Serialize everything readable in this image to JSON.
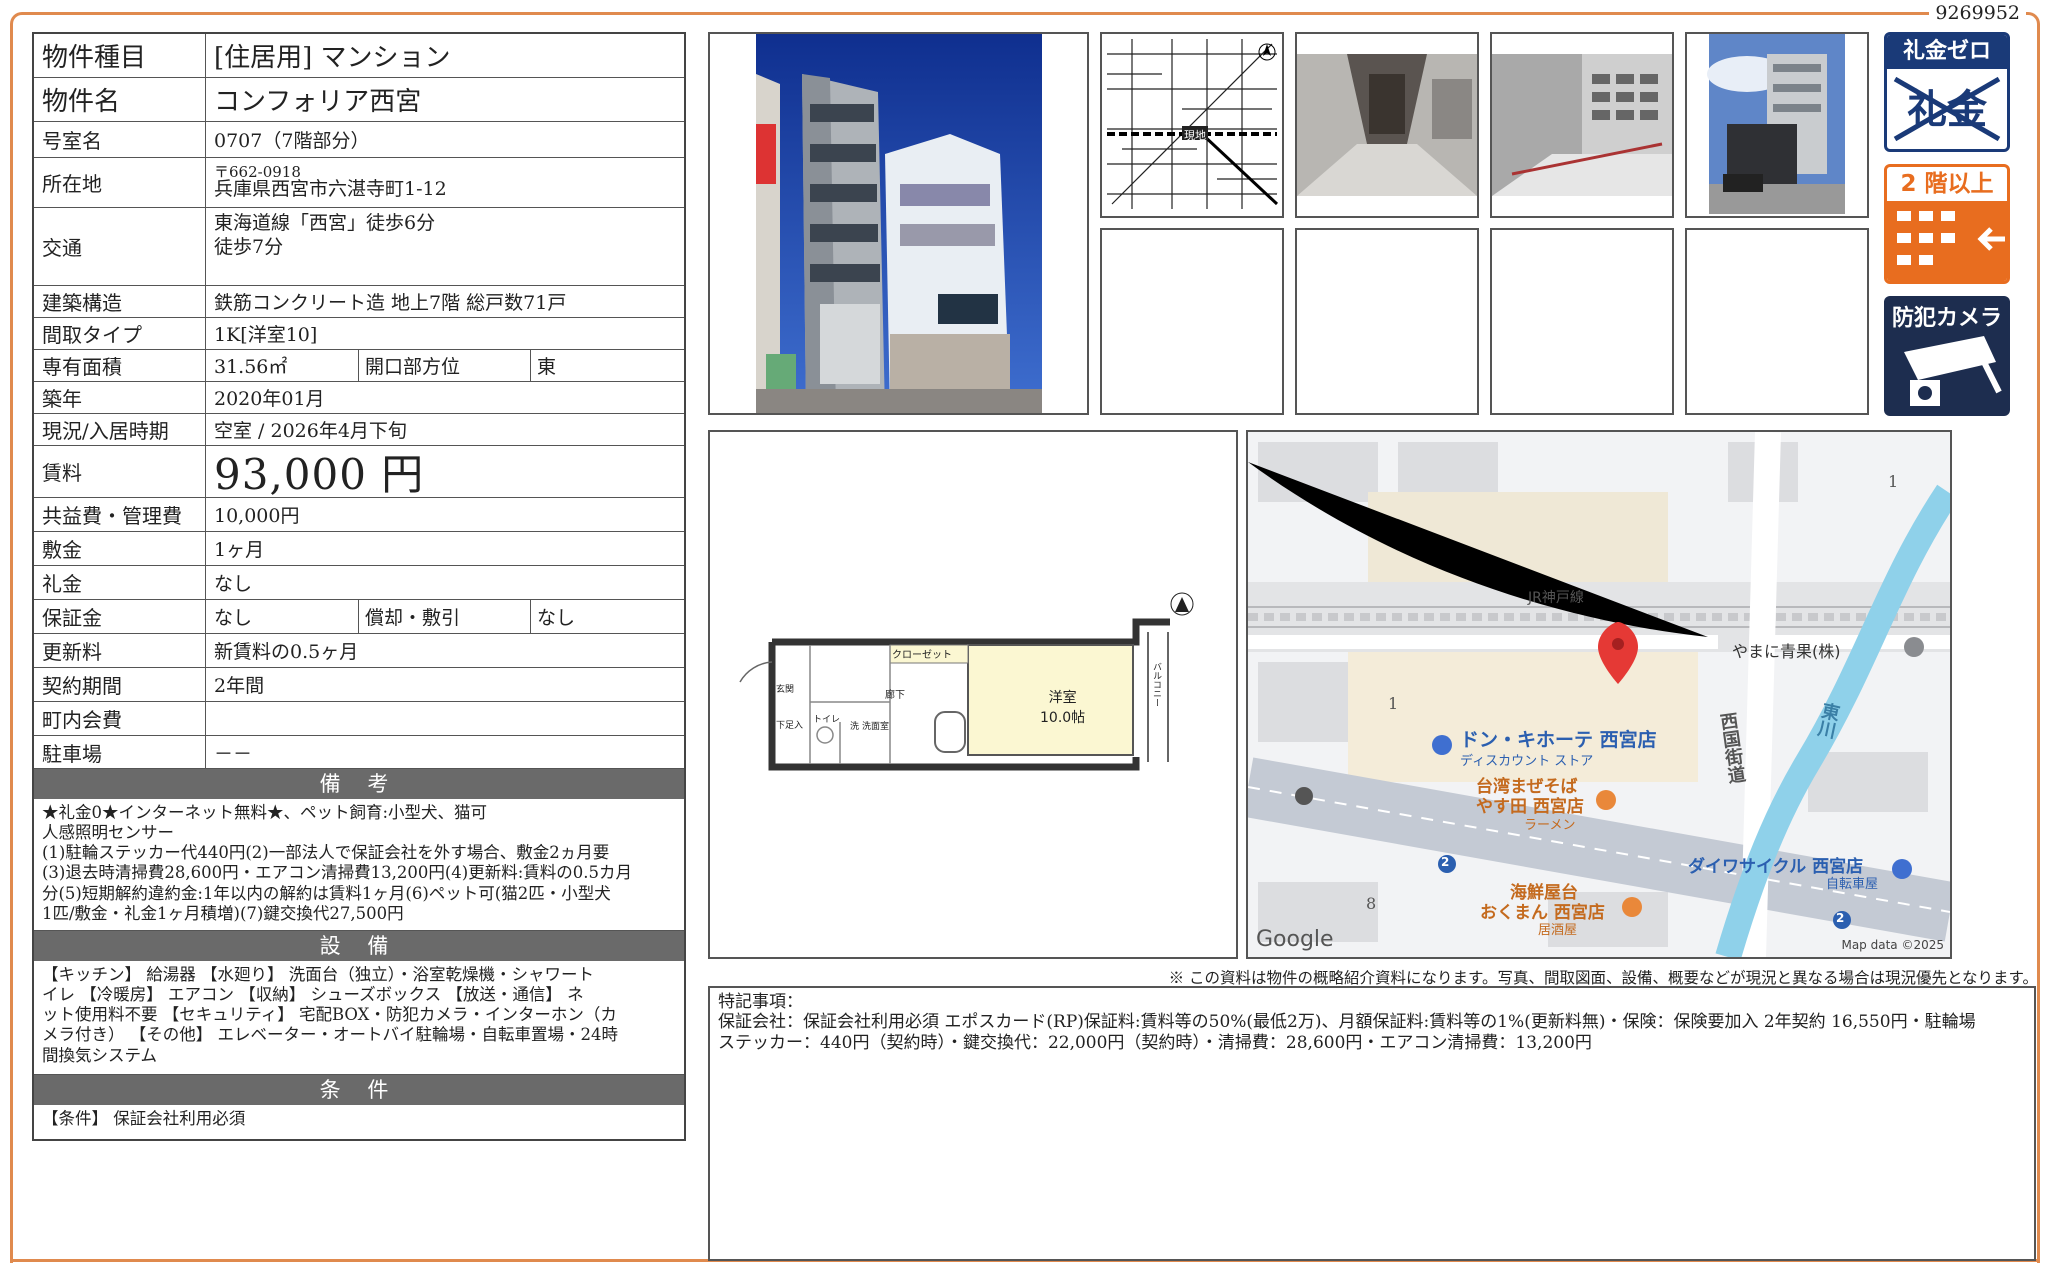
{
  "doc_id": "9269952",
  "property": {
    "type_label": "物件種目",
    "type_value": "[住居用]  マンション",
    "name_label": "物件名",
    "name_value": "コンフォリア西宮",
    "room_label": "号室名",
    "room_value": "0707（7階部分）",
    "address_label": "所在地",
    "zip": "〒662-0918",
    "address": "兵庫県西宮市六湛寺町1-12",
    "transport_label": "交通",
    "transport_1": "東海道線「西宮」徒歩6分",
    "transport_2": "徒歩7分",
    "structure_label": "建築構造",
    "structure_value": "鉄筋コンクリート造  地上7階  総戸数71戸",
    "layout_label": "間取タイプ",
    "layout_value": "1K[洋室10]",
    "area_label": "専有面積",
    "area_value": "31.56㎡",
    "direction_label": "開口部方位",
    "direction_value": "東",
    "built_label": "築年",
    "built_value": "2020年01月",
    "status_label": "現況/入居時期",
    "status_value": "空室  /  2026年4月下旬",
    "rent_label": "賃料",
    "rent_value": "93,000 円",
    "fee_label": "共益費・管理費",
    "fee_value": "10,000円",
    "deposit_label": "敷金",
    "deposit_value": "1ヶ月",
    "key_money_label": "礼金",
    "key_money_value": "なし",
    "guarantee_label": "保証金",
    "guarantee_value": "なし",
    "amort_label": "償却・敷引",
    "amort_value": "なし",
    "renewal_label": "更新料",
    "renewal_value": "新賃料の0.5ヶ月",
    "contract_label": "契約期間",
    "contract_value": "2年間",
    "town_fee_label": "町内会費",
    "town_fee_value": "",
    "parking_label": "駐車場",
    "parking_value": "－－"
  },
  "remarks": {
    "title": "備 考",
    "lines": [
      "★礼金0★インターネット無料★、ペット飼育:小型犬、猫可",
      "人感照明センサー",
      "(1)駐輪ステッカー代440円(2)一部法人で保証会社を外す場合、敷金2ヵ月要",
      "(3)退去時清掃費28,600円・エアコン清掃費13,200円(4)更新料:賃料の0.5カ月",
      "分(5)短期解約違約金:1年以内の解約は賃料1ヶ月(6)ペット可(猫2匹・小型犬",
      "1匹/敷金・礼金1ヶ月積増)(7)鍵交換代27,500円"
    ]
  },
  "equipment": {
    "title": "設 備",
    "lines": [
      "【キッチン】 給湯器 【水廻り】 洗面台（独立）・浴室乾燥機・シャワート",
      "イレ 【冷暖房】 エアコン 【収納】 シューズボックス 【放送・通信】 ネ",
      "ット使用料不要 【セキュリティ】 宅配BOX・防犯カメラ・インターホン（カ",
      "メラ付き） 【その他】 エレベーター・オートバイ駐輪場・自転車置場・24時",
      "間換気システム"
    ]
  },
  "conditions": {
    "title": "条 件",
    "text": "【条件】  保証会社利用必須"
  },
  "badges": {
    "reikin_zero_top": "礼金ゼロ",
    "reikin_zero_crossed": "礼金",
    "floor2": "2 階以上",
    "camera": "防犯カメラ"
  },
  "floorplan": {
    "room_label": "洋室",
    "room_size": "10.0帖",
    "closet": "クローゼット",
    "hall": "廊下",
    "entrance": "玄関",
    "shoebox": "下足入",
    "toilet": "トイレ",
    "wash": "洗",
    "washroom": "洗面室",
    "balcony": "バルコニー"
  },
  "map": {
    "rail_label": "JR神戸線",
    "shop1": "やまに青果(株)",
    "store_name": "ドン・キホーテ 西宮店",
    "store_sub": "ディスカウント ストア",
    "ramen_1": "台湾まぜそば",
    "ramen_2": "やす田 西宮店",
    "ramen_sub": "ラーメン",
    "izakaya_1": "海鮮屋台",
    "izakaya_2": "おくまん 西宮店",
    "izakaya_sub": "居酒屋",
    "cycle_name": "ダイワサイクル 西宮店",
    "cycle_sub": "自転車屋",
    "street1": "西国街道",
    "river": "東川",
    "num1": "1",
    "num2": "1",
    "num3": "8",
    "route1": "2",
    "route2": "2",
    "google": "Google",
    "copyright": "Map data ©2025"
  },
  "location_map_label": "現地",
  "disclaimer": "※ この資料は物件の概略紹介資料になります。写真、間取図面、設備、概要などが現況と異なる場合は現況優先となります。",
  "special_notes": {
    "title": "特記事項：",
    "line1": "保証会社：保証会社利用必須 エポスカード(RP)保証料:賃料等の50%(最低2万)、月額保証料:賃料等の1%(更新料無)・保険：保険要加入 2年契約 16,550円・駐輪場",
    "line2": "ステッカー：440円（契約時）・鍵交換代：22,000円（契約時）・清掃費：28,600円・エアコン清掃費：13,200円"
  }
}
